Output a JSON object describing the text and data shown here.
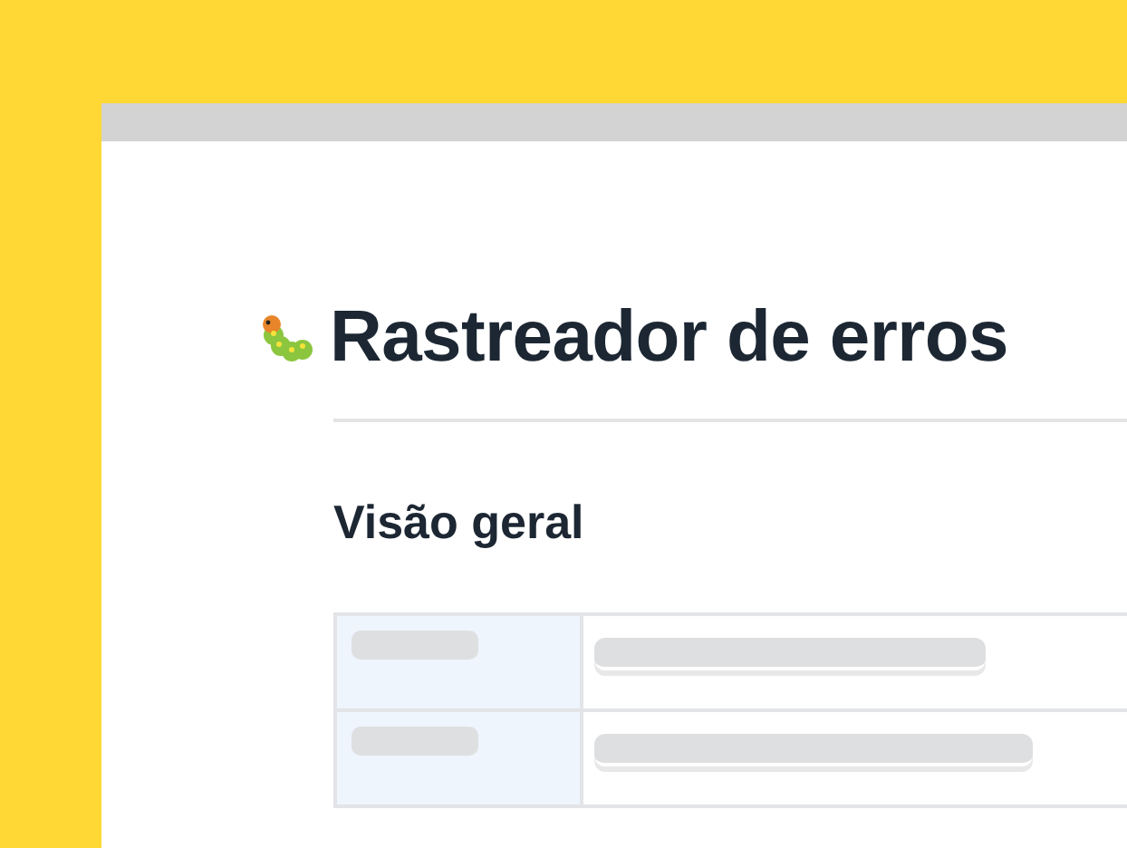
{
  "page": {
    "title": "Rastreador de erros",
    "section_heading": "Visão geral"
  },
  "table": {
    "rows": [
      {
        "kind": "skeleton"
      },
      {
        "kind": "skeleton"
      }
    ]
  }
}
